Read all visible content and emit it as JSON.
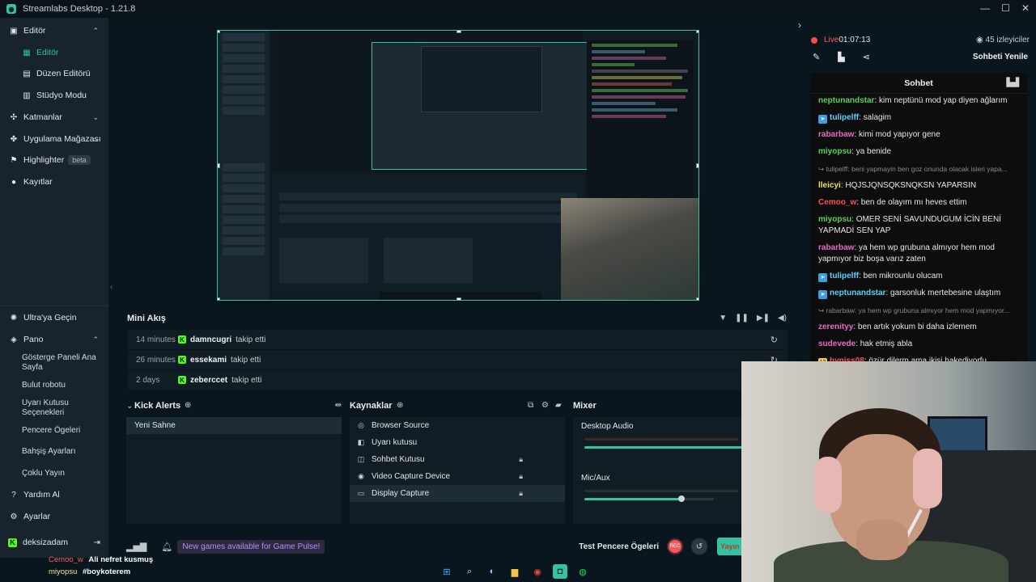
{
  "window": {
    "title": "Streamlabs Desktop - 1.21.8",
    "controls": [
      "—",
      "☐",
      "✕"
    ]
  },
  "sidebar": {
    "sections": [
      {
        "label": "Editör",
        "icon": "editor-icon",
        "chevron": "⌃"
      },
      {
        "label": "Katmanlar",
        "icon": "layers-icon",
        "chevron": "⌄"
      },
      {
        "label": "Uygulama Mağazası",
        "icon": "store-icon",
        "chevron": "⌄"
      },
      {
        "label": "Highlighter",
        "icon": "highlighter-icon",
        "badge": "beta"
      },
      {
        "label": "Kayıtlar",
        "icon": "recordings-icon"
      }
    ],
    "editor_items": [
      {
        "label": "Editör",
        "icon": "grid-icon",
        "active": true
      },
      {
        "label": "Düzen Editörü",
        "icon": "layout-icon"
      },
      {
        "label": "Stüdyo Modu",
        "icon": "studio-icon"
      }
    ],
    "bottom": [
      {
        "label": "Ultra'ya Geçin",
        "icon": "ultra-icon"
      },
      {
        "label": "Pano",
        "icon": "dashboard-icon",
        "chevron": "⌃"
      }
    ],
    "pano_items": [
      "Gösterge Paneli Ana Sayfa",
      "Bulut robotu",
      "Uyarı Kutusu Seçenekleri",
      "Pencere Ögeleri",
      "Bahşiş Ayarları",
      "Çoklu Yayın"
    ],
    "help": "Yardım Al",
    "settings": "Ayarlar",
    "username": "deksizadam"
  },
  "mini_feed": {
    "title": "Mini Akış",
    "rows": [
      {
        "time": "14 minutes",
        "name": "damncugri",
        "action": "takip etti"
      },
      {
        "time": "26 minutes",
        "name": "essekami",
        "action": "takip etti"
      },
      {
        "time": "2 days",
        "name": "zeberccet",
        "action": "takip etti"
      }
    ]
  },
  "kick_alerts": {
    "title": "Kick Alerts",
    "scenes": [
      "Yeni Sahne"
    ]
  },
  "sources": {
    "title": "Kaynaklar",
    "items": [
      {
        "label": "Browser Source",
        "icon": "globe-icon",
        "locked": false,
        "selected": false
      },
      {
        "label": "Uyarı kutusu",
        "icon": "alert-icon",
        "locked": false,
        "selected": false
      },
      {
        "label": "Sohbet Kutusu",
        "icon": "chat-icon",
        "locked": true,
        "selected": false
      },
      {
        "label": "Video Capture Device",
        "icon": "camera-icon",
        "locked": true,
        "selected": false
      },
      {
        "label": "Display Capture",
        "icon": "monitor-icon",
        "locked": true,
        "selected": true
      }
    ]
  },
  "mixer": {
    "title": "Mixer",
    "channels": [
      {
        "label": "Desktop Audio",
        "level": 1.0
      },
      {
        "label": "Mic/Aux",
        "level": 0.75
      }
    ]
  },
  "footer": {
    "notification": "New games available for Game Pulse!",
    "test_label": "Test Pencere Ögeleri",
    "rec_label": "REC",
    "golive_label": "Yayın"
  },
  "overlay_chat": [
    {
      "user": "Cemoo_w",
      "msg": "Ali nefret kusmuş"
    },
    {
      "user": "miyopsu",
      "msg": "#boykoterem"
    }
  ],
  "right_panel": {
    "live_label": "Live",
    "live_time": "01:07:13",
    "viewers": "45 izleyiciler",
    "refresh_label": "Sohbeti Yenile",
    "chat_title": "Sohbet",
    "messages": [
      {
        "user": "neptunandstar",
        "text": "kim neptünü mod yap diyen ağlarım",
        "color": "#5ad15a",
        "badge": ""
      },
      {
        "user": "tulipelff",
        "text": "salagim",
        "color": "#5ad1ff",
        "badge": "kick"
      },
      {
        "user": "rabarbaw",
        "text": "kimi mod yapıyor gene",
        "color": "#e86ac8",
        "badge": ""
      },
      {
        "user": "miyopsu",
        "text": "ya benide",
        "color": "#5ad15a",
        "badge": ""
      },
      {
        "user": "tulipelff",
        "text": "beni yapmayin ben goz onunda olacak isleri yapa...",
        "color": "#8a8a8a",
        "badge": "",
        "deleted": true
      },
      {
        "user": "lleicyi",
        "text": "HQJSJQNSQKSNQKSN YAPARSIN",
        "color": "#f0e060",
        "badge": ""
      },
      {
        "user": "Cemoo_w",
        "text": "ben de olayım mı heves ettim",
        "color": "#ff5050",
        "badge": ""
      },
      {
        "user": "miyopsu",
        "text": "OMER SENİ SAVUNDUGUM İCİN BENİ YAPMADİ SEN YAP",
        "color": "#5ad15a",
        "badge": ""
      },
      {
        "user": "rabarbaw",
        "text": "ya hem wp grubuna almıyor hem mod yapmıyor biz boşa varız zaten",
        "color": "#e86ac8",
        "badge": ""
      },
      {
        "user": "tulipelff",
        "text": "ben mikrounlu olucam",
        "color": "#5ad1ff",
        "badge": "kick"
      },
      {
        "user": "neptunandstar",
        "text": "garsonluk mertebesine ulaştım",
        "color": "#5ad1ff",
        "badge": "kick"
      },
      {
        "user": "rabarbaw",
        "text": "ya hem wp grubuna almıyor hem mod yapmıyor...",
        "color": "#8a8a8a",
        "badge": "",
        "deleted": true
      },
      {
        "user": "zerenityy",
        "text": "ben artık yokum bi daha izlemem",
        "color": "#e86ac8",
        "badge": ""
      },
      {
        "user": "sudevede",
        "text": "hak etmiş abla",
        "color": "#e86ac8",
        "badge": ""
      },
      {
        "user": "hyniss08",
        "text": "özür dilerm ama ikisi hakediyorfu...",
        "color": "#ff5050",
        "badge": "12"
      }
    ]
  },
  "colors": {
    "accent": "#31c3a2",
    "kick": "#53fc18",
    "background": "#09161d",
    "panel": "#111d24"
  }
}
